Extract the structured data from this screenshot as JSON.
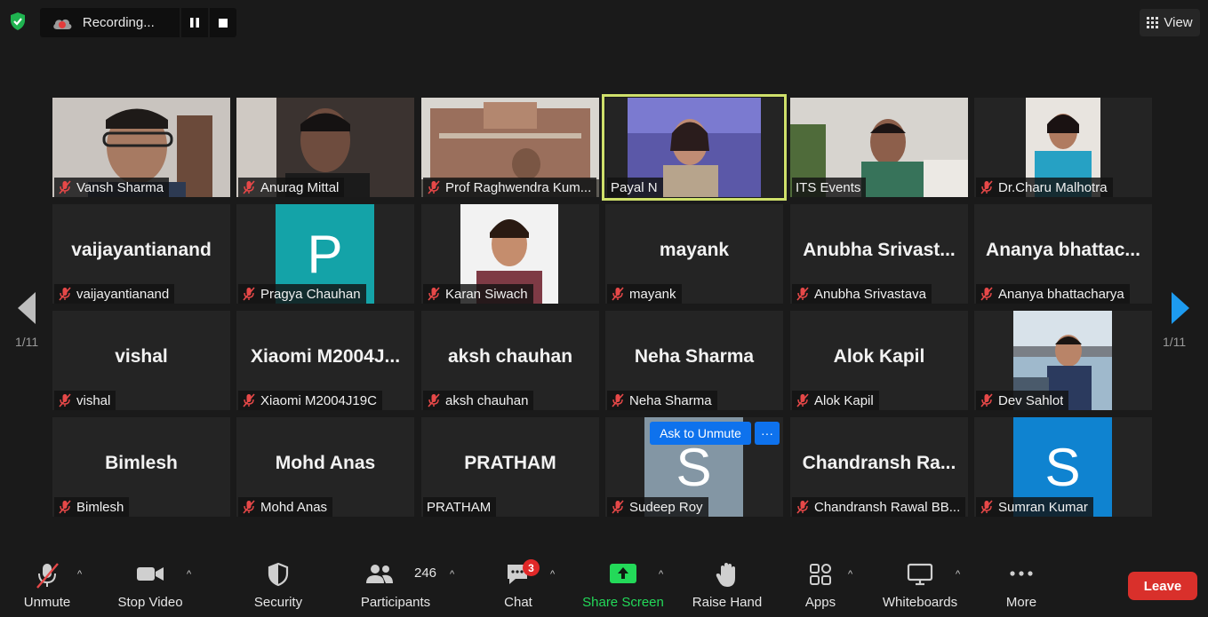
{
  "recording": {
    "label": "Recording..."
  },
  "view": {
    "label": "View"
  },
  "pagination": {
    "left": "1/11",
    "right": "1/11"
  },
  "tiles": [
    {
      "name": "Vansh Sharma",
      "big": "",
      "muted": true
    },
    {
      "name": "Anurag Mittal",
      "big": "",
      "muted": true
    },
    {
      "name": "Prof Raghwendra Kum...",
      "big": "",
      "muted": true
    },
    {
      "name": "Payal N",
      "big": "",
      "muted": false
    },
    {
      "name": "ITS Events",
      "big": "",
      "muted": false
    },
    {
      "name": "Dr.Charu Malhotra",
      "big": "",
      "muted": true
    },
    {
      "name": "vaijayantianand",
      "big": "vaijayantianand",
      "muted": true
    },
    {
      "name": "Pragya Chauhan",
      "big": "",
      "muted": true,
      "letter": "P"
    },
    {
      "name": "Karan Siwach",
      "big": "",
      "muted": true
    },
    {
      "name": "mayank",
      "big": "mayank",
      "muted": true
    },
    {
      "name": "Anubha Srivastava",
      "big": "Anubha Srivast...",
      "muted": true
    },
    {
      "name": "Ananya bhattacharya",
      "big": "Ananya bhattac...",
      "muted": true
    },
    {
      "name": "vishal",
      "big": "vishal",
      "muted": true
    },
    {
      "name": "Xiaomi M2004J19C",
      "big": "Xiaomi M2004J...",
      "muted": true
    },
    {
      "name": "aksh chauhan",
      "big": "aksh chauhan",
      "muted": true
    },
    {
      "name": "Neha Sharma",
      "big": "Neha Sharma",
      "muted": true
    },
    {
      "name": "Alok Kapil",
      "big": "Alok Kapil",
      "muted": true
    },
    {
      "name": "Dev Sahlot",
      "big": "",
      "muted": true
    },
    {
      "name": "Bimlesh",
      "big": "Bimlesh",
      "muted": true
    },
    {
      "name": "Mohd Anas",
      "big": "Mohd Anas",
      "muted": true
    },
    {
      "name": "PRATHAM",
      "big": "PRATHAM",
      "muted": false
    },
    {
      "name": "Sudeep Roy",
      "big": "",
      "muted": true,
      "letter": "S"
    },
    {
      "name": "Chandransh Rawal BB...",
      "big": "Chandransh Ra...",
      "muted": true
    },
    {
      "name": "Sumran Kumar",
      "big": "",
      "muted": true,
      "letter": "S"
    }
  ],
  "hover": {
    "ask_label": "Ask to Unmute",
    "more_label": "···"
  },
  "toolbar": {
    "unmute": "Unmute",
    "stop_video": "Stop Video",
    "security": "Security",
    "participants": "Participants",
    "participants_count": "246",
    "chat": "Chat",
    "chat_badge": "3",
    "share_screen": "Share Screen",
    "raise_hand": "Raise Hand",
    "apps": "Apps",
    "whiteboards": "Whiteboards",
    "more": "More",
    "leave": "Leave"
  },
  "colors": {
    "active_speaker": "#cfe06b",
    "share_green": "#23d959",
    "leave_red": "#d9302b",
    "accent_blue": "#0e72ed"
  }
}
